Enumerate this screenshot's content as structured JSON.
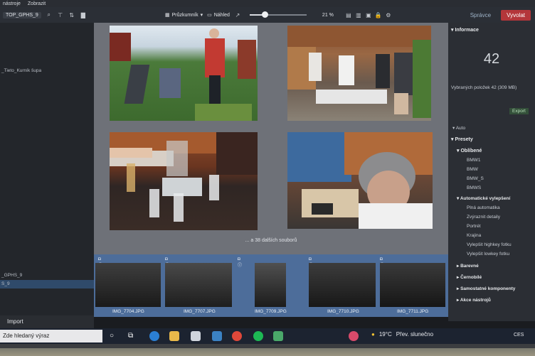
{
  "menubar": {
    "items": [
      "nástroje",
      "Zobrazit"
    ]
  },
  "toolbar": {
    "path": "TOP_GPHS_9",
    "browser_label": "Průzkumník",
    "preview_label": "Náhled",
    "zoom": "21 %",
    "zoom_level": 0.21
  },
  "modes": {
    "manage": "Správce",
    "develop": "Vyvolat"
  },
  "left_panel": {
    "items": [
      {
        "label": "_Tieto_Kurník šupa"
      },
      {
        "label": "_GPHS_9"
      },
      {
        "label": "S_9"
      }
    ],
    "import_label": "Import"
  },
  "grid": {
    "more_label": "... a 38 dalších souborů"
  },
  "filmstrip": {
    "items": [
      {
        "name": "IMG_7704.JPG"
      },
      {
        "name": "IMG_7707.JPG"
      },
      {
        "name": "IMG_7709.JPG"
      },
      {
        "name": "IMG_7710.JPG"
      },
      {
        "name": "IMG_7711.JPG"
      }
    ]
  },
  "right_panel": {
    "info_title": "Informace",
    "count": "42",
    "selected_label": "Vybraných položek 42 (309 MB)",
    "export_label": "Export",
    "auto_label": "Auto",
    "presets_title": "Presety",
    "favorites_title": "Oblíbené",
    "favorites": [
      "BMW1",
      "BMW",
      "BMW_S",
      "BMWS"
    ],
    "auto_improve_title": "Automatické vylepšení",
    "auto_improve": [
      "Plná automatika",
      "Zvýraznit detaily",
      "Portrét",
      "Krajina",
      "Vylepšit highkey fotku",
      "Vylepšit lowkey fotku"
    ],
    "groups": [
      "Barevné",
      "Černobílé",
      "Samostatné komponenty",
      "Akce nástrojů"
    ]
  },
  "taskbar": {
    "search_placeholder": "Zde hledaný výraz",
    "temperature": "19°C",
    "weather": "Přev. slunečno",
    "lang": "CES"
  }
}
